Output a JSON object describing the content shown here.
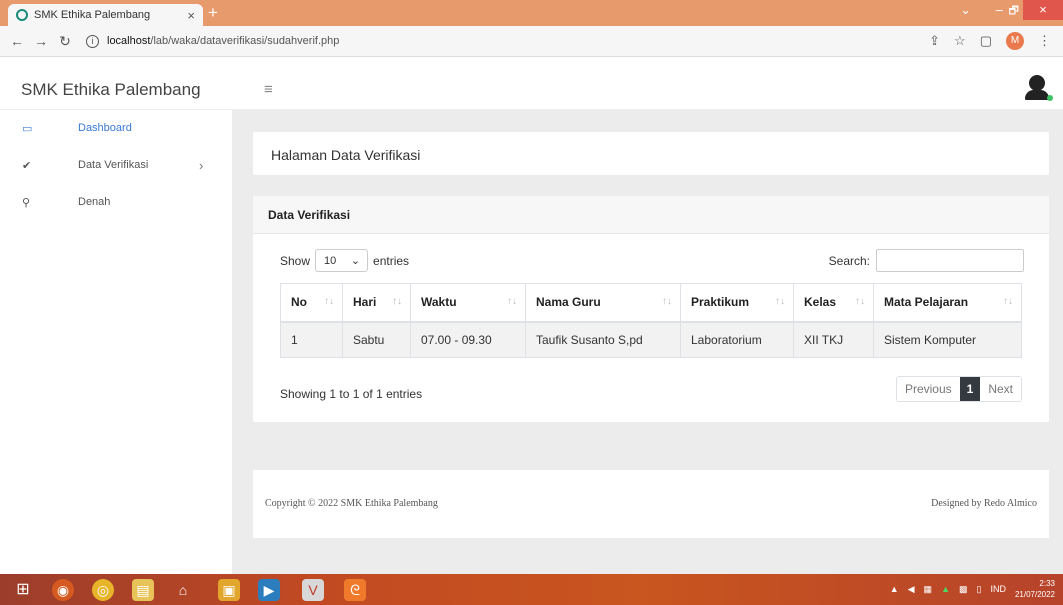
{
  "browser": {
    "tab_title": "SMK Ethika Palembang",
    "tab_close": "×",
    "new_tab": "+",
    "url_host": "localhost",
    "url_path": "/lab/waka/dataverifikasi/sudahverif.php",
    "profile_initial": "M",
    "min": "–",
    "max": "🗗",
    "close": "×",
    "tab_list": "⌄"
  },
  "app": {
    "brand": "SMK Ethika Palembang",
    "menu_icon": "≡"
  },
  "sidebar": {
    "items": [
      {
        "label": "Dashboard",
        "icon": "laptop-icon",
        "glyph": "▭"
      },
      {
        "label": "Data Verifikasi",
        "icon": "check-icon",
        "glyph": "✔",
        "chevron": "›"
      },
      {
        "label": "Denah",
        "icon": "map-pin-icon",
        "glyph": "⚲"
      }
    ]
  },
  "page": {
    "title": "Halaman Data Verifikasi",
    "card_title": "Data Verifikasi"
  },
  "table_controls": {
    "show_label": "Show",
    "entries_value": "10",
    "entries_label": "entries",
    "search_label": "Search:",
    "search_value": "",
    "info": "Showing 1 to 1 of 1 entries",
    "previous": "Previous",
    "current_page": "1",
    "next": "Next"
  },
  "table": {
    "columns": [
      "No",
      "Hari",
      "Waktu",
      "Nama Guru",
      "Praktikum",
      "Kelas",
      "Mata Pelajaran"
    ],
    "rows": [
      [
        "1",
        "Sabtu",
        "07.00 - 09.30",
        "Taufik Susanto S,pd",
        "Laboratorium",
        "XII TKJ",
        "Sistem Komputer"
      ]
    ]
  },
  "footer": {
    "copyright": "Copyright © 2022 SMK Ethika Palembang",
    "designed": "Designed by Redo Almico"
  },
  "taskbar": {
    "lang": "IND",
    "time": "2:33",
    "date": "21/07/2022"
  }
}
